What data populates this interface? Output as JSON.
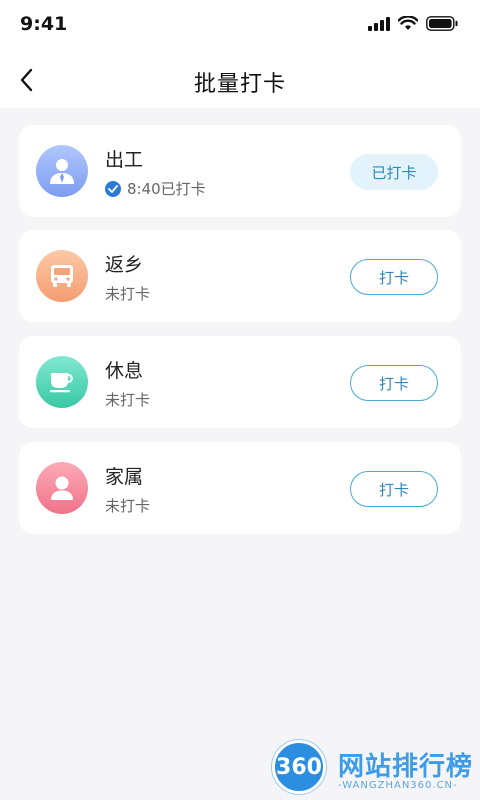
{
  "status_bar": {
    "time": "9:41"
  },
  "nav": {
    "title": "批量打卡"
  },
  "cards": [
    {
      "name": "出工",
      "status": "8:40已打卡",
      "button": "已打卡",
      "avatar_icon": "worker-icon",
      "checked": true,
      "colors": [
        "#a9c2fb",
        "#7f9ef2"
      ]
    },
    {
      "name": "返乡",
      "status": "未打卡",
      "button": "打卡",
      "avatar_icon": "bus-icon",
      "checked": false,
      "colors": [
        "#fcc6a3",
        "#f59e74"
      ]
    },
    {
      "name": "休息",
      "status": "未打卡",
      "button": "打卡",
      "avatar_icon": "coffee-cup-icon",
      "checked": false,
      "colors": [
        "#7ee6cf",
        "#3ccaa7"
      ]
    },
    {
      "name": "家属",
      "status": "未打卡",
      "button": "打卡",
      "avatar_icon": "person-icon",
      "checked": false,
      "colors": [
        "#fba6b3",
        "#f0768c"
      ]
    }
  ],
  "watermark": {
    "badge": "360",
    "text": "网站排行榜",
    "sub": "-WANGZHAN360.CN-"
  },
  "theme": {
    "accent": "#2f88b8",
    "check_blue": "#2a7bd8"
  }
}
